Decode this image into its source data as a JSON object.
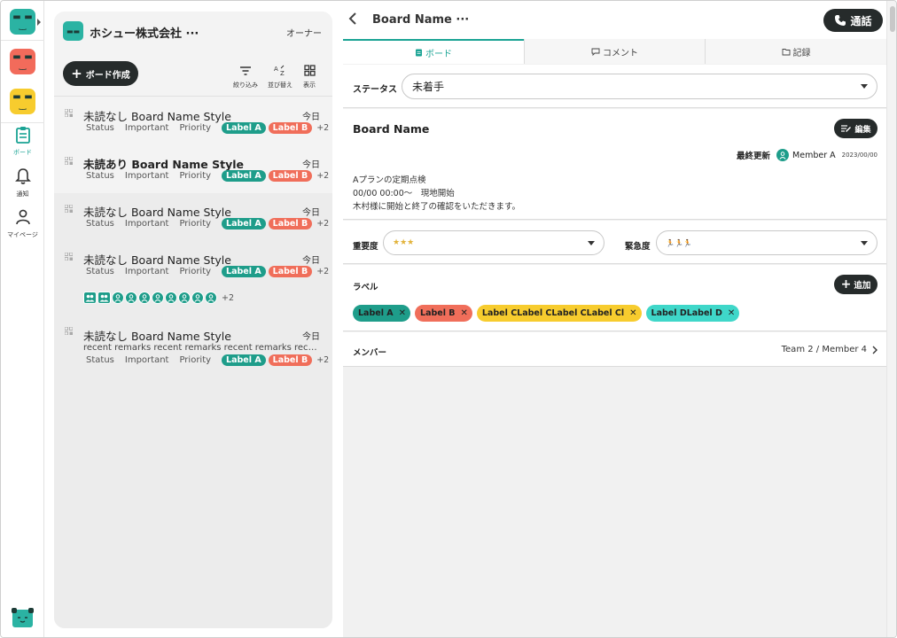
{
  "rail": {
    "workspaces": [
      {
        "color": "#2bb3a3",
        "face": "-_-"
      },
      {
        "color": "#f26b5b",
        "face": "-_-"
      },
      {
        "color": "#f7cc2e",
        "face": "-_-"
      }
    ],
    "nav": [
      {
        "label": "ボード",
        "icon": "clipboard-icon",
        "active": true
      },
      {
        "label": "通知",
        "icon": "bell-icon",
        "active": false
      },
      {
        "label": "マイページ",
        "icon": "person-icon",
        "active": false
      }
    ]
  },
  "list": {
    "org_name": "ホシュー株式会社 ···",
    "role": "オーナー",
    "create_label": "ボード作成",
    "tools": [
      {
        "label": "絞り込み",
        "icon": "filter-icon"
      },
      {
        "label": "並び替え",
        "icon": "sort-az-icon"
      },
      {
        "label": "表示",
        "icon": "grid-view-icon"
      }
    ],
    "items": [
      {
        "title": "未読なし Board Name Style",
        "bold": false,
        "date": "今日",
        "meta": [
          "Status",
          "Important",
          "Priority"
        ],
        "labels": [
          "Label A",
          "Label B"
        ],
        "more": "+2"
      },
      {
        "title": "未読あり Board Name Style",
        "bold": true,
        "date": "今日",
        "meta": [
          "Status",
          "Important",
          "Priority"
        ],
        "labels": [
          "Label A",
          "Label B"
        ],
        "more": "+2"
      },
      {
        "title": "未読なし Board Name Style",
        "bold": false,
        "date": "今日",
        "meta": [
          "Status",
          "Important",
          "Priority"
        ],
        "labels": [
          "Label A",
          "Label B"
        ],
        "more": "+2"
      },
      {
        "title": "未読なし Board Name Style",
        "bold": false,
        "date": "今日",
        "meta": [
          "Status",
          "Important",
          "Priority"
        ],
        "labels": [
          "Label A",
          "Label B"
        ],
        "more": "+2",
        "avatars_more": "+2"
      },
      {
        "title": "未読なし Board Name Style",
        "bold": false,
        "date": "今日",
        "remarks": "recent remarks recent remarks recent remarks recent remarks",
        "meta": [
          "Status",
          "Important",
          "Priority"
        ],
        "labels": [
          "Label A",
          "Label B"
        ],
        "more": "+2"
      }
    ]
  },
  "detail": {
    "title": "Board Name ···",
    "call_label": "通話",
    "tabs": [
      {
        "label": "ボード",
        "icon": "clipboard-icon"
      },
      {
        "label": "コメント",
        "icon": "comment-icon"
      },
      {
        "label": "記録",
        "icon": "folder-icon"
      }
    ],
    "status_label": "ステータス",
    "status_value": "未着手",
    "board_name": "Board Name",
    "edit_label": "編集",
    "updated_label": "最終更新",
    "updated_by": "Member A",
    "updated_date": "2023/00/00",
    "desc_lines": [
      "Aプランの定期点検",
      "00/00 00:00〜　現地開始",
      "木村様に開始と終了の確認をいただきます。"
    ],
    "importance_label": "重要度",
    "importance_value": "★★★",
    "urgency_label": "緊急度",
    "urgency_value": "🏃🏃🏃",
    "label_section": "ラベル",
    "add_label": "追加",
    "labels": [
      {
        "text": "Label A",
        "color": "#1e9d8a"
      },
      {
        "text": "Label B",
        "color": "#f06e5a"
      },
      {
        "text": "Label CLabel CLabel CLabel Cl",
        "color": "#f7cc2e"
      },
      {
        "text": "Label DLabel D",
        "color": "#3fd7c9"
      }
    ],
    "member_label": "メンバー",
    "member_value": "Team 2 / Member 4"
  }
}
